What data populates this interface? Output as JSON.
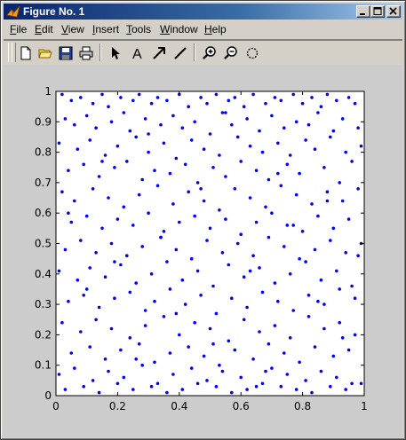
{
  "window": {
    "title": "Figure No. 1"
  },
  "menubar": {
    "items": [
      {
        "key": "F",
        "rest": "ile"
      },
      {
        "key": "E",
        "rest": "dit"
      },
      {
        "key": "V",
        "rest": "iew"
      },
      {
        "key": "I",
        "rest": "nsert"
      },
      {
        "key": "T",
        "rest": "ools"
      },
      {
        "key": "W",
        "rest": "indow"
      },
      {
        "key": "H",
        "rest": "elp"
      }
    ]
  },
  "toolbar": {
    "buttons": [
      "new-file-icon",
      "open-folder-icon",
      "save-icon",
      "print-icon",
      "edit-arrow-icon",
      "insert-text-icon",
      "insert-arrow-icon",
      "insert-line-icon",
      "zoom-in-icon",
      "zoom-out-icon",
      "rotate-3d-icon"
    ]
  },
  "colors": {
    "marker": "#0000ff",
    "axes_bg": "#ffffff",
    "figure_bg": "#cccccc"
  },
  "chart_data": {
    "type": "scatter",
    "title": "",
    "xlabel": "",
    "ylabel": "",
    "xlim": [
      0,
      1
    ],
    "ylim": [
      0,
      1
    ],
    "xticks": [
      "0",
      "0.2",
      "0.4",
      "0.6",
      "0.8",
      "1"
    ],
    "yticks": [
      "0",
      "0.1",
      "0.2",
      "0.3",
      "0.4",
      "0.5",
      "0.6",
      "0.7",
      "0.8",
      "0.9",
      "1"
    ],
    "grid": false,
    "marker": ".",
    "x": [
      0.02,
      0.05,
      0.08,
      0.12,
      0.15,
      0.17,
      0.21,
      0.25,
      0.27,
      0.31,
      0.33,
      0.36,
      0.4,
      0.43,
      0.47,
      0.49,
      0.52,
      0.56,
      0.58,
      0.61,
      0.64,
      0.68,
      0.71,
      0.73,
      0.77,
      0.8,
      0.83,
      0.86,
      0.88,
      0.91,
      0.95,
      0.97,
      0.03,
      0.06,
      0.1,
      0.13,
      0.18,
      0.22,
      0.24,
      0.29,
      0.34,
      0.38,
      0.41,
      0.45,
      0.5,
      0.54,
      0.57,
      0.62,
      0.66,
      0.7,
      0.74,
      0.78,
      0.82,
      0.85,
      0.9,
      0.93,
      0.98,
      0.01,
      0.07,
      0.11,
      0.16,
      0.2,
      0.26,
      0.3,
      0.35,
      0.39,
      0.44,
      0.48,
      0.53,
      0.59,
      0.63,
      0.67,
      0.72,
      0.76,
      0.81,
      0.84,
      0.89,
      0.94,
      0.99,
      0.04,
      0.09,
      0.14,
      0.19,
      0.23,
      0.28,
      0.32,
      0.37,
      0.42,
      0.46,
      0.51,
      0.55,
      0.6,
      0.65,
      0.69,
      0.75,
      0.79,
      0.87,
      0.92,
      0.96,
      0.02,
      0.06,
      0.12,
      0.17,
      0.22,
      0.27,
      0.33,
      0.38,
      0.43,
      0.48,
      0.53,
      0.58,
      0.63,
      0.68,
      0.73,
      0.78,
      0.83,
      0.88,
      0.93,
      0.98,
      0.05,
      0.1,
      0.15,
      0.2,
      0.25,
      0.3,
      0.35,
      0.4,
      0.45,
      0.5,
      0.55,
      0.6,
      0.65,
      0.7,
      0.75,
      0.8,
      0.85,
      0.9,
      0.95,
      0.03,
      0.08,
      0.13,
      0.18,
      0.23,
      0.28,
      0.34,
      0.39,
      0.44,
      0.49,
      0.54,
      0.59,
      0.64,
      0.69,
      0.74,
      0.79,
      0.84,
      0.89,
      0.94,
      0.99,
      0.01,
      0.07,
      0.11,
      0.16,
      0.21,
      0.26,
      0.31,
      0.36,
      0.41,
      0.46,
      0.51,
      0.56,
      0.61,
      0.66,
      0.71,
      0.76,
      0.81,
      0.86,
      0.91,
      0.96,
      0.04,
      0.09,
      0.14,
      0.19,
      0.24,
      0.29,
      0.32,
      0.37,
      0.42,
      0.47,
      0.52,
      0.57,
      0.62,
      0.67,
      0.72,
      0.77,
      0.82,
      0.87,
      0.92,
      0.97,
      0.02,
      0.08,
      0.13,
      0.18,
      0.24,
      0.29,
      0.35,
      0.4,
      0.45,
      0.5,
      0.56,
      0.61,
      0.66,
      0.71,
      0.76,
      0.82,
      0.87,
      0.92,
      0.97,
      0.05,
      0.11,
      0.16,
      0.21,
      0.27,
      0.32,
      0.37,
      0.43,
      0.48,
      0.53,
      0.58,
      0.64,
      0.69,
      0.74,
      0.79,
      0.84,
      0.9,
      0.95,
      0.01,
      0.06,
      0.12,
      0.17,
      0.22,
      0.28,
      0.33,
      0.38,
      0.44,
      0.49,
      0.54,
      0.6,
      0.65,
      0.7,
      0.75,
      0.81,
      0.86,
      0.91,
      0.96,
      0.03,
      0.09,
      0.14,
      0.2,
      0.25,
      0.31,
      0.36,
      0.41,
      0.46,
      0.52,
      0.57,
      0.62,
      0.67,
      0.73,
      0.78,
      0.83,
      0.89,
      0.94,
      0.99,
      0.04,
      0.1,
      0.15,
      0.19,
      0.26,
      0.3,
      0.34,
      0.39,
      0.47,
      0.51,
      0.55,
      0.63,
      0.68,
      0.72,
      0.77,
      0.85,
      0.88,
      0.93,
      0.98
    ],
    "y": [
      0.99,
      0.97,
      0.98,
      0.96,
      0.99,
      0.95,
      0.98,
      0.97,
      0.99,
      0.96,
      0.98,
      0.97,
      0.99,
      0.95,
      0.98,
      0.96,
      0.99,
      0.97,
      0.98,
      0.95,
      0.99,
      0.96,
      0.98,
      0.97,
      0.99,
      0.96,
      0.98,
      0.95,
      0.99,
      0.97,
      0.98,
      0.96,
      0.91,
      0.89,
      0.92,
      0.88,
      0.9,
      0.93,
      0.87,
      0.91,
      0.89,
      0.92,
      0.88,
      0.9,
      0.86,
      0.93,
      0.89,
      0.91,
      0.87,
      0.92,
      0.88,
      0.9,
      0.89,
      0.93,
      0.87,
      0.91,
      0.88,
      0.83,
      0.81,
      0.84,
      0.79,
      0.82,
      0.85,
      0.8,
      0.83,
      0.78,
      0.84,
      0.81,
      0.79,
      0.85,
      0.82,
      0.8,
      0.83,
      0.79,
      0.84,
      0.81,
      0.85,
      0.8,
      0.82,
      0.74,
      0.76,
      0.72,
      0.75,
      0.77,
      0.71,
      0.74,
      0.73,
      0.76,
      0.7,
      0.75,
      0.72,
      0.77,
      0.74,
      0.71,
      0.76,
      0.73,
      0.75,
      0.7,
      0.77,
      0.67,
      0.64,
      0.68,
      0.65,
      0.62,
      0.66,
      0.69,
      0.63,
      0.67,
      0.64,
      0.61,
      0.68,
      0.65,
      0.62,
      0.69,
      0.66,
      0.63,
      0.67,
      0.64,
      0.68,
      0.57,
      0.59,
      0.55,
      0.58,
      0.56,
      0.6,
      0.54,
      0.57,
      0.59,
      0.55,
      0.58,
      0.53,
      0.57,
      0.6,
      0.56,
      0.54,
      0.59,
      0.55,
      0.58,
      0.48,
      0.51,
      0.47,
      0.5,
      0.46,
      0.49,
      0.52,
      0.48,
      0.45,
      0.51,
      0.47,
      0.5,
      0.46,
      0.52,
      0.49,
      0.45,
      0.48,
      0.51,
      0.47,
      0.5,
      0.41,
      0.38,
      0.42,
      0.39,
      0.43,
      0.37,
      0.4,
      0.44,
      0.38,
      0.41,
      0.36,
      0.43,
      0.39,
      0.42,
      0.37,
      0.4,
      0.44,
      0.38,
      0.41,
      0.36,
      0.31,
      0.33,
      0.29,
      0.32,
      0.34,
      0.28,
      0.31,
      0.35,
      0.3,
      0.33,
      0.27,
      0.32,
      0.29,
      0.34,
      0.31,
      0.28,
      0.33,
      0.3,
      0.35,
      0.32,
      0.24,
      0.21,
      0.25,
      0.22,
      0.19,
      0.23,
      0.26,
      0.2,
      0.24,
      0.22,
      0.18,
      0.25,
      0.21,
      0.23,
      0.19,
      0.26,
      0.22,
      0.24,
      0.2,
      0.14,
      0.16,
      0.12,
      0.15,
      0.17,
      0.11,
      0.14,
      0.16,
      0.13,
      0.1,
      0.15,
      0.12,
      0.17,
      0.14,
      0.11,
      0.16,
      0.13,
      0.15,
      0.07,
      0.09,
      0.05,
      0.08,
      0.06,
      0.1,
      0.04,
      0.07,
      0.09,
      0.05,
      0.08,
      0.06,
      0.03,
      0.09,
      0.07,
      0.05,
      0.08,
      0.06,
      0.04,
      0.02,
      0.03,
      0.01,
      0.04,
      0.02,
      0.03,
      0.01,
      0.02,
      0.04,
      0.03,
      0.01,
      0.02,
      0.04,
      0.03,
      0.02,
      0.01,
      0.03,
      0.02,
      0.04,
      0.6,
      0.35,
      0.77,
      0.44,
      0.12,
      0.86,
      0.52,
      0.27,
      0.68,
      0.17,
      0.93,
      0.41,
      0.08,
      0.73,
      0.56,
      0.31,
      0.64,
      0.19,
      0.46
    ]
  }
}
